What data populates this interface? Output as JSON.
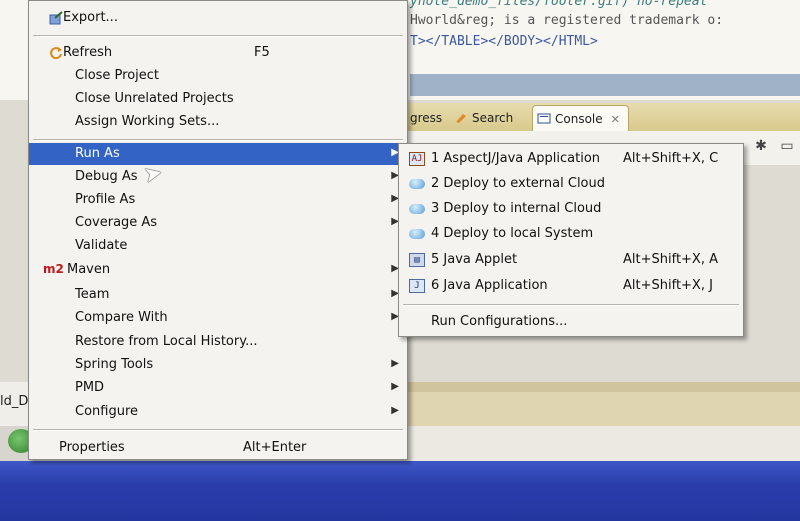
{
  "editor": {
    "lines": [
      "ynote_demo_files/footer.gif) no-repeat",
      "Hworld&reg; is a registered trademark o:",
      "T></TABLE></BODY></HTML>"
    ]
  },
  "views": {
    "tabs": {
      "progress": "gress",
      "search": "Search",
      "console": "Console"
    }
  },
  "status": {
    "left_text": "ld_D"
  },
  "context_menu": {
    "items": [
      {
        "id": "export",
        "label": "Export...",
        "icon": "export-icon"
      },
      {
        "id": "refresh",
        "label": "Refresh",
        "shortcut": "F5",
        "icon": "refresh-icon"
      },
      {
        "id": "close-project",
        "label": "Close Project"
      },
      {
        "id": "close-unrelated",
        "label": "Close Unrelated Projects"
      },
      {
        "id": "assign-working-sets",
        "label": "Assign Working Sets..."
      },
      {
        "id": "run-as",
        "label": "Run As",
        "submenu": true,
        "highlighted": true
      },
      {
        "id": "debug-as",
        "label": "Debug As",
        "submenu": true
      },
      {
        "id": "profile-as",
        "label": "Profile As",
        "submenu": true
      },
      {
        "id": "coverage-as",
        "label": "Coverage As",
        "submenu": true
      },
      {
        "id": "validate",
        "label": "Validate"
      },
      {
        "id": "maven",
        "label": "Maven",
        "icon_text": "m2",
        "submenu": true
      },
      {
        "id": "team",
        "label": "Team",
        "submenu": true
      },
      {
        "id": "compare-with",
        "label": "Compare With",
        "submenu": true
      },
      {
        "id": "restore-local-history",
        "label": "Restore from Local History..."
      },
      {
        "id": "spring-tools",
        "label": "Spring Tools",
        "submenu": true
      },
      {
        "id": "pmd",
        "label": "PMD",
        "submenu": true
      },
      {
        "id": "configure",
        "label": "Configure",
        "submenu": true
      },
      {
        "id": "properties",
        "label": "Properties",
        "shortcut": "Alt+Enter"
      }
    ]
  },
  "run_as_submenu": {
    "items": [
      {
        "label": "1 AspectJ/Java Application",
        "shortcut": "Alt+Shift+X, C",
        "icon": "aspectj-app-icon"
      },
      {
        "label": "2 Deploy to external Cloud",
        "shortcut": "",
        "icon": "cloud-icon"
      },
      {
        "label": "3 Deploy to internal Cloud",
        "shortcut": "",
        "icon": "cloud-icon"
      },
      {
        "label": "4 Deploy to local System",
        "shortcut": "",
        "icon": "cloud-icon"
      },
      {
        "label": "5 Java Applet",
        "shortcut": "Alt+Shift+X, A",
        "icon": "java-applet-icon"
      },
      {
        "label": "6 Java Application",
        "shortcut": "Alt+Shift+X, J",
        "icon": "java-app-icon"
      },
      {
        "label": "Run Configurations...",
        "shortcut": "",
        "icon": ""
      }
    ]
  },
  "colors": {
    "menu_highlight": "#3363c4",
    "taskbar": "#2a3dab",
    "maven_red": "#c0181c"
  }
}
